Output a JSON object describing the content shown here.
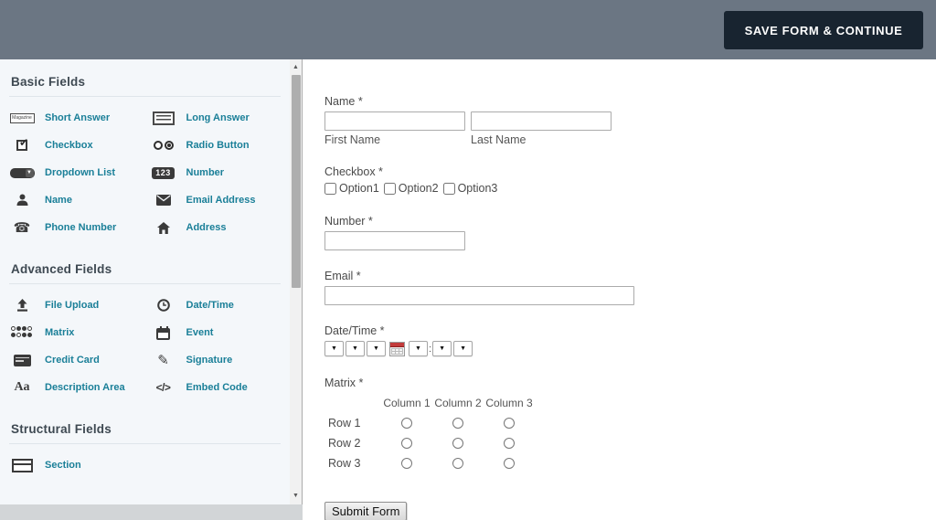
{
  "header": {
    "save_button_label": "SAVE FORM & CONTINUE"
  },
  "sidebar": {
    "sections": [
      {
        "title": "Basic Fields",
        "items": [
          {
            "label": "Short Answer",
            "icon": "short-answer-icon",
            "icon_text": "Magazine"
          },
          {
            "label": "Long Answer",
            "icon": "long-answer-icon"
          },
          {
            "label": "Checkbox",
            "icon": "checkbox-icon"
          },
          {
            "label": "Radio Button",
            "icon": "radio-button-icon"
          },
          {
            "label": "Dropdown List",
            "icon": "dropdown-list-icon"
          },
          {
            "label": "Number",
            "icon": "number-icon",
            "icon_text": "123"
          },
          {
            "label": "Name",
            "icon": "person-icon"
          },
          {
            "label": "Email Address",
            "icon": "envelope-icon"
          },
          {
            "label": "Phone Number",
            "icon": "phone-icon"
          },
          {
            "label": "Address",
            "icon": "house-icon"
          }
        ]
      },
      {
        "title": "Advanced Fields",
        "items": [
          {
            "label": "File Upload",
            "icon": "upload-icon",
            "icon_text": "⬆"
          },
          {
            "label": "Date/Time",
            "icon": "clock-icon",
            "icon_text": "◷"
          },
          {
            "label": "Matrix",
            "icon": "matrix-grid-icon"
          },
          {
            "label": "Event",
            "icon": "calendar-icon"
          },
          {
            "label": "Credit Card",
            "icon": "credit-card-icon"
          },
          {
            "label": "Signature",
            "icon": "pen-icon",
            "icon_text": "✎"
          },
          {
            "label": "Description Area",
            "icon": "description-icon",
            "icon_text": "Aa"
          },
          {
            "label": "Embed Code",
            "icon": "embed-code-icon",
            "icon_text": "</>"
          }
        ]
      },
      {
        "title": "Structural Fields",
        "items": [
          {
            "label": "Section",
            "icon": "section-icon"
          }
        ]
      }
    ]
  },
  "form": {
    "name_field": {
      "label": "Name *",
      "first_sublabel": "First Name",
      "last_sublabel": "Last Name"
    },
    "checkbox_field": {
      "label": "Checkbox *",
      "options": [
        "Option1",
        "Option2",
        "Option3"
      ]
    },
    "number_field": {
      "label": "Number *"
    },
    "email_field": {
      "label": "Email *"
    },
    "datetime_field": {
      "label": "Date/Time *",
      "separator": ":",
      "dropdown_glyph": "▼"
    },
    "matrix_field": {
      "label": "Matrix *",
      "columns": [
        "Column 1",
        "Column 2",
        "Column 3"
      ],
      "rows": [
        "Row 1",
        "Row 2",
        "Row 3"
      ]
    },
    "submit_button_label": "Submit Form"
  },
  "colors": {
    "header_bg": "#6b7683",
    "save_button_bg": "#182430",
    "sidebar_bg": "#f4f7fa",
    "sidebar_item_text": "#1a7f98",
    "section_title_text": "#3e4952",
    "calendar_icon_red": "#c23b3b"
  }
}
